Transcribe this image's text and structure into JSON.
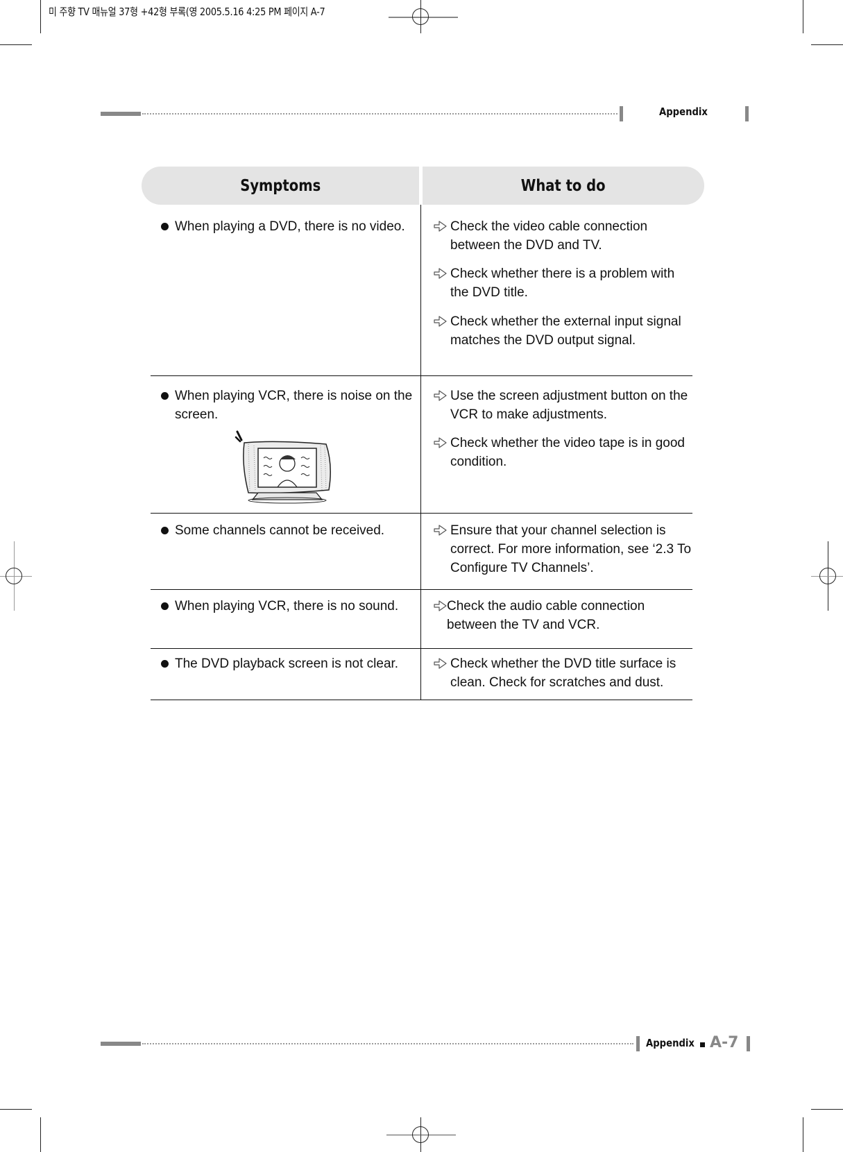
{
  "print_slug": {
    "text": "미 주향 TV 매뉴얼 37형 +42형 부록(영   2005.5.16 4:25 PM 페이지 A-7"
  },
  "running_header": {
    "title": "Appendix"
  },
  "table": {
    "headers": {
      "symptoms": "Symptoms",
      "what_to_do": "What to do"
    },
    "rows": [
      {
        "symptom": "When playing a DVD, there is no video.",
        "actions": [
          "Check the video cable connection between the DVD and TV.",
          "Check whether there is a problem with the DVD title.",
          "Check whether the external input signal matches the DVD output signal."
        ]
      },
      {
        "symptom": "When playing VCR, there is noise on the screen.",
        "illustration": "tv-with-noisy-screen-illustration",
        "actions": [
          "Use the screen adjustment button on the VCR to make adjustments.",
          "Check whether the video tape is in good condition."
        ]
      },
      {
        "symptom": "Some channels cannot be received.",
        "actions": [
          "Ensure that your channel selection is correct. For more information, see ‘2.3 To Configure TV Channels’."
        ]
      },
      {
        "symptom": "When playing VCR, there is no sound.",
        "actions": [
          "Check the audio cable connection between the TV and VCR."
        ]
      },
      {
        "symptom": "The DVD playback screen is not clear.",
        "actions": [
          "Check whether the DVD title surface is clean. Check for scratches and dust."
        ]
      }
    ]
  },
  "footer": {
    "section": "Appendix",
    "page_number": "A-7"
  },
  "icons": {
    "bullet": "filled-circle-bullet-icon",
    "action": "outlined-right-arrow-icon"
  }
}
